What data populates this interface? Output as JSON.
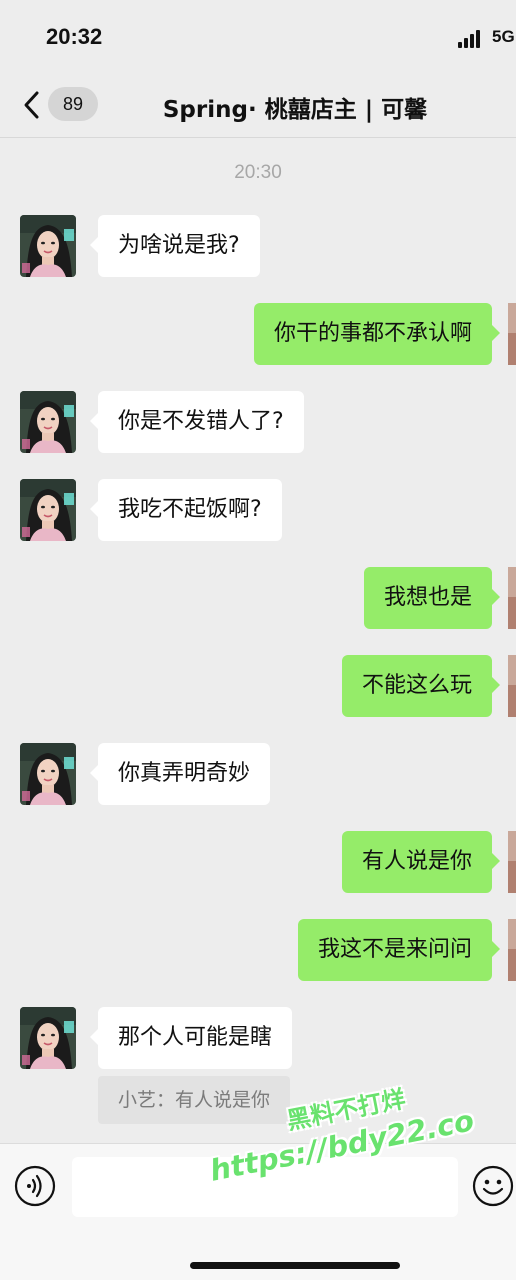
{
  "status_bar": {
    "time": "20:32",
    "network": "5G",
    "signal_icon": "cellular-signal-icon"
  },
  "nav": {
    "back_icon": "chevron-left-icon",
    "unread_count": "89",
    "title": "Spring· 桃囍店主 | 可馨"
  },
  "chat": {
    "timestamp": "20:30",
    "messages": [
      {
        "side": "in",
        "text": "为啥说是我?"
      },
      {
        "side": "out",
        "text": "你干的事都不承认啊"
      },
      {
        "side": "in",
        "text": "你是不发错人了?"
      },
      {
        "side": "in",
        "text": "我吃不起饭啊?"
      },
      {
        "side": "out",
        "text": "我想也是"
      },
      {
        "side": "out",
        "text": "不能这么玩"
      },
      {
        "side": "in",
        "text": "你真弄明奇妙"
      },
      {
        "side": "out",
        "text": "有人说是你"
      },
      {
        "side": "out",
        "text": "我这不是来问问"
      },
      {
        "side": "in",
        "text": "那个人可能是瞎"
      }
    ],
    "quote": "小艺：有人说是你"
  },
  "input_bar": {
    "voice_icon": "voice-icon",
    "emoji_icon": "emoji-icon"
  },
  "watermark": {
    "line1": "黑料不打烊",
    "line2": "https://bdy22.co"
  },
  "colors": {
    "background": "#ededed",
    "outgoing_bubble": "#95ec69",
    "incoming_bubble": "#ffffff",
    "watermark": "#69e26e"
  }
}
